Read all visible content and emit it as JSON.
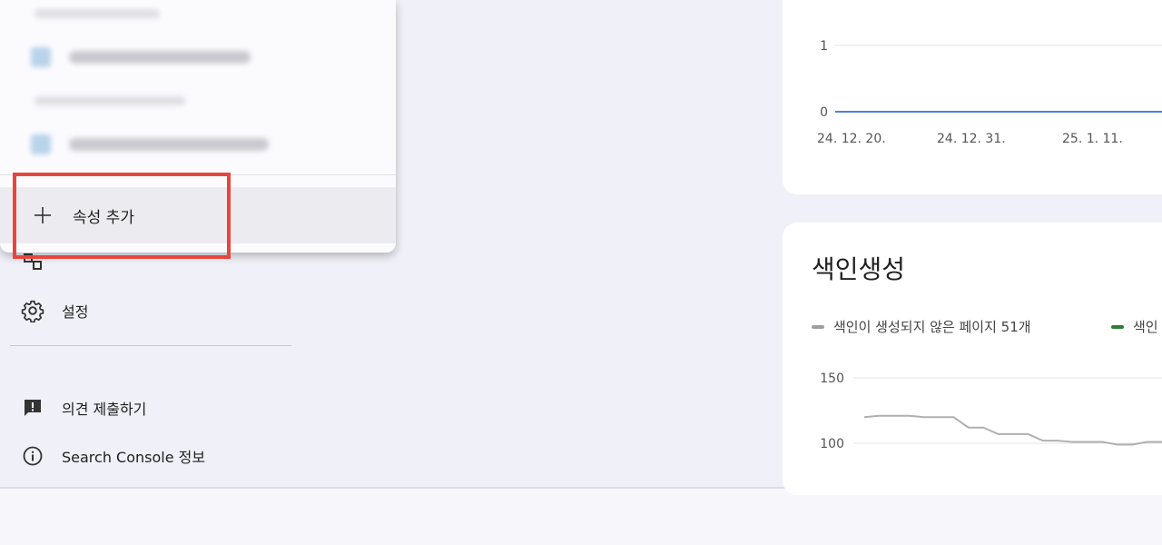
{
  "sidebar": {
    "items": [
      {
        "label": "설정",
        "icon": "gear-icon"
      }
    ],
    "footer": [
      {
        "label": "의견 제출하기",
        "icon": "feedback-icon"
      },
      {
        "label": "Search Console 정보",
        "icon": "info-icon"
      }
    ]
  },
  "property_menu": {
    "add_property_label": "속성 추가",
    "add_icon": "plus-icon"
  },
  "top_chart": {
    "chart_data": {
      "type": "line",
      "y_ticks": [
        "1",
        "0"
      ],
      "x_ticks": [
        "24. 12. 20.",
        "24. 12. 31.",
        "25. 1. 11."
      ],
      "ylim": [
        0,
        1
      ],
      "series": [
        {
          "color": "#4a7fe0",
          "values": [
            0,
            0,
            0,
            0,
            0
          ]
        }
      ]
    }
  },
  "index_card": {
    "title": "색인생성",
    "legend": [
      {
        "label": "색인이 생성되지 않은 페이지 51개",
        "color": "#9e9e9e"
      },
      {
        "label": "색인",
        "color": "#2e7d32"
      }
    ],
    "chart_data": {
      "type": "line",
      "y_ticks": [
        "150",
        "100"
      ],
      "ylim": [
        100,
        150
      ],
      "series": [
        {
          "name": "색인이 생성되지 않은 페이지 51개",
          "color": "#b0b0b0",
          "values": [
            120,
            121,
            121,
            121,
            120,
            120,
            120,
            112,
            112,
            107,
            107,
            107,
            102,
            102,
            101,
            101,
            101,
            99,
            99,
            101,
            101
          ]
        }
      ]
    }
  }
}
